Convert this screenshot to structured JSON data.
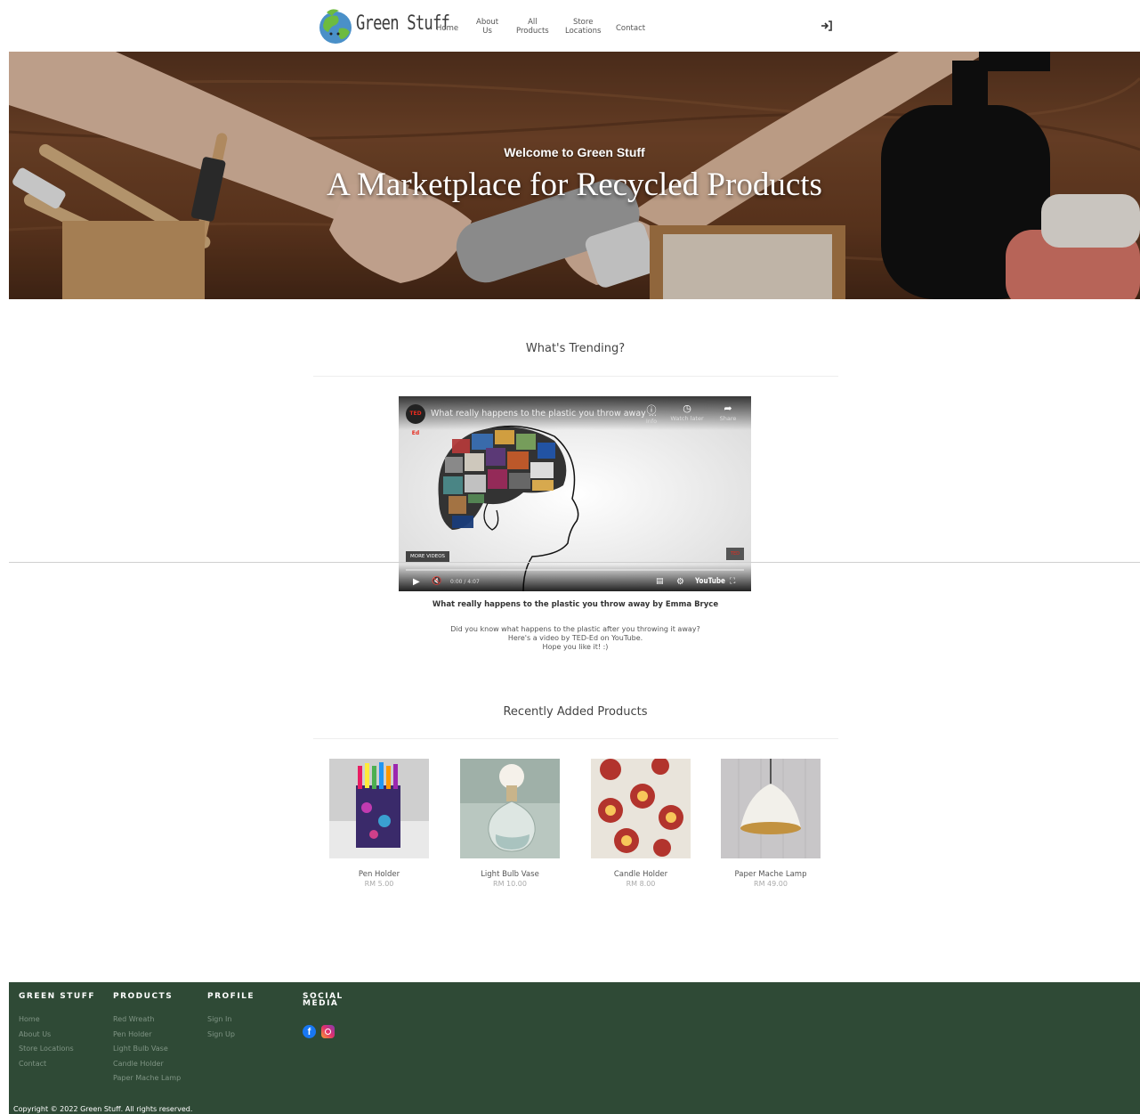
{
  "brand": {
    "name": "Green Stuff"
  },
  "nav": {
    "items": [
      {
        "label": "Home"
      },
      {
        "label": "About\nUs"
      },
      {
        "label": "All\nProducts"
      },
      {
        "label": "Store\nLocations"
      },
      {
        "label": "Contact"
      }
    ],
    "login_icon": "sign-in-icon"
  },
  "hero": {
    "subtitle": "Welcome to Green Stuff",
    "title": "A Marketplace for Recycled Products"
  },
  "trending": {
    "title": "What's Trending?",
    "video": {
      "title": "What really happens to the plastic you throw away ...",
      "channel_logo": "TED Ed",
      "info_label": "Info",
      "watch_later_label": "Watch later",
      "share_label": "Share",
      "more_videos_label": "MORE VIDEOS",
      "time": "0:00 / 4:07",
      "youtube_label": "YouTube"
    },
    "caption": "What really happens to the plastic you throw away by Emma Bryce",
    "description": [
      "Did you know what happens to the plastic after you throwing it away?",
      "Here's a video by TED-Ed on YouTube.",
      "Hope you like it! :)"
    ]
  },
  "recent": {
    "title": "Recently Added Products",
    "products": [
      {
        "name": "Pen Holder",
        "price": "RM 5.00"
      },
      {
        "name": "Light Bulb Vase",
        "price": "RM 10.00"
      },
      {
        "name": "Candle Holder",
        "price": "RM 8.00"
      },
      {
        "name": "Paper Mache Lamp",
        "price": "RM 49.00"
      }
    ]
  },
  "footer": {
    "columns": [
      {
        "heading": "GREEN STUFF",
        "links": [
          "Home",
          "About Us",
          "Store Locations",
          "Contact"
        ]
      },
      {
        "heading": "PRODUCTS",
        "links": [
          "Red Wreath",
          "Pen Holder",
          "Light Bulb Vase",
          "Candle Holder",
          "Paper Mache Lamp"
        ]
      },
      {
        "heading": "PROFILE",
        "links": [
          "Sign In",
          "Sign Up"
        ]
      },
      {
        "heading": "SOCIAL MEDIA",
        "links": []
      }
    ],
    "social": {
      "facebook": "f"
    },
    "copyright": "Copyright © 2022 Green Stuff. All rights reserved."
  },
  "colors": {
    "footer_bg": "#2f4a36",
    "link_muted": "#7f9484"
  }
}
